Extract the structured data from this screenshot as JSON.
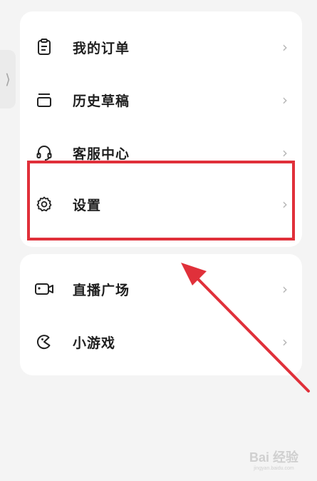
{
  "side_tab": {
    "glyph": "⟩"
  },
  "menu_primary": [
    {
      "label": "我的订单",
      "icon": "clipboard-icon",
      "chevron": "›"
    },
    {
      "label": "历史草稿",
      "icon": "drafts-tray-icon",
      "chevron": "›"
    },
    {
      "label": "客服中心",
      "icon": "headset-icon",
      "chevron": "›"
    },
    {
      "label": "设置",
      "icon": "gear-icon",
      "chevron": "›"
    }
  ],
  "menu_secondary": [
    {
      "label": "直播广场",
      "icon": "video-camera-icon",
      "chevron": "›"
    },
    {
      "label": "小游戏",
      "icon": "game-icon",
      "chevron": "›"
    }
  ],
  "annotation": {
    "highlight_color": "#e0303a",
    "arrow_color": "#e0303a",
    "target": "设置"
  },
  "watermark": {
    "main": "Bai 经验",
    "sub": "jingyan.baidu.com"
  }
}
